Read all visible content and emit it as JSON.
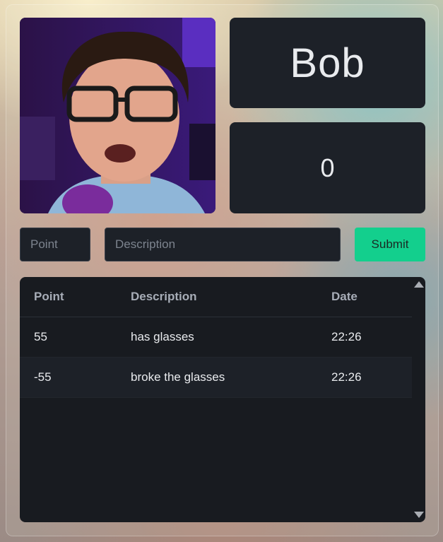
{
  "profile": {
    "photo_icon": "person-photo",
    "name": "Bob",
    "score": "0"
  },
  "form": {
    "point_placeholder": "Point",
    "description_placeholder": "Description",
    "submit_label": "Submit"
  },
  "table": {
    "headers": [
      "Point",
      "Description",
      "Date"
    ],
    "rows": [
      {
        "point": "55",
        "description": "has glasses",
        "date": "22:26"
      },
      {
        "point": "-55",
        "description": "broke the glasses",
        "date": "22:26"
      }
    ]
  },
  "colors": {
    "submit": "#13cf8d",
    "card": "#1d2128",
    "table": "#181b20"
  }
}
